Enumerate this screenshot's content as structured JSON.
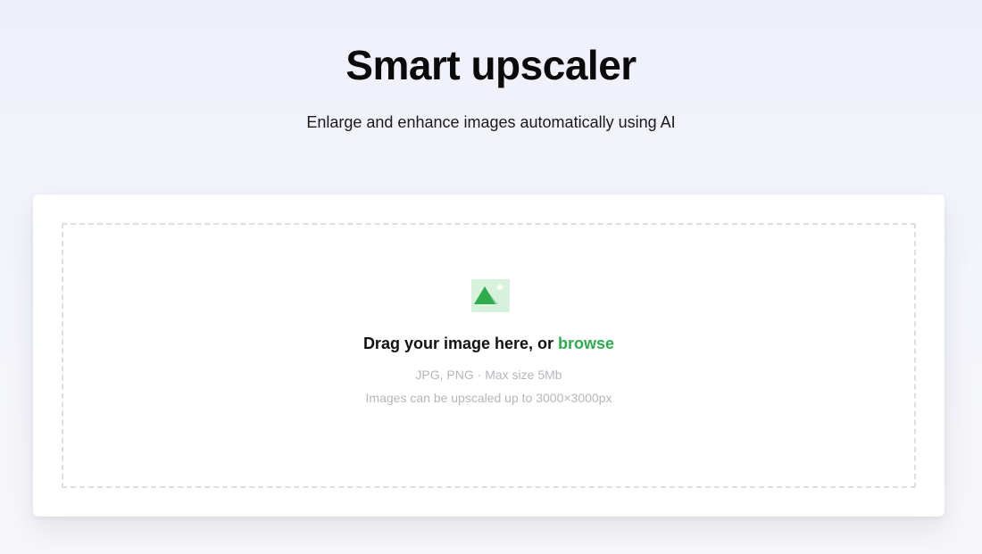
{
  "hero": {
    "title": "Smart upscaler",
    "subtitle": "Enlarge and enhance images automatically using AI"
  },
  "upload": {
    "icon": "image-icon",
    "heading_text": "Drag your image here, or ",
    "browse_label": "browse",
    "formats_hint": "JPG, PNG · Max size 5Mb",
    "limit_hint": "Images can be upscaled up to 3000×3000px"
  },
  "colors": {
    "accent": "#2eac4e",
    "icon_bg": "#d6f1dc",
    "hint_text": "#b4b6bb",
    "dash_border": "#dcdee3"
  }
}
